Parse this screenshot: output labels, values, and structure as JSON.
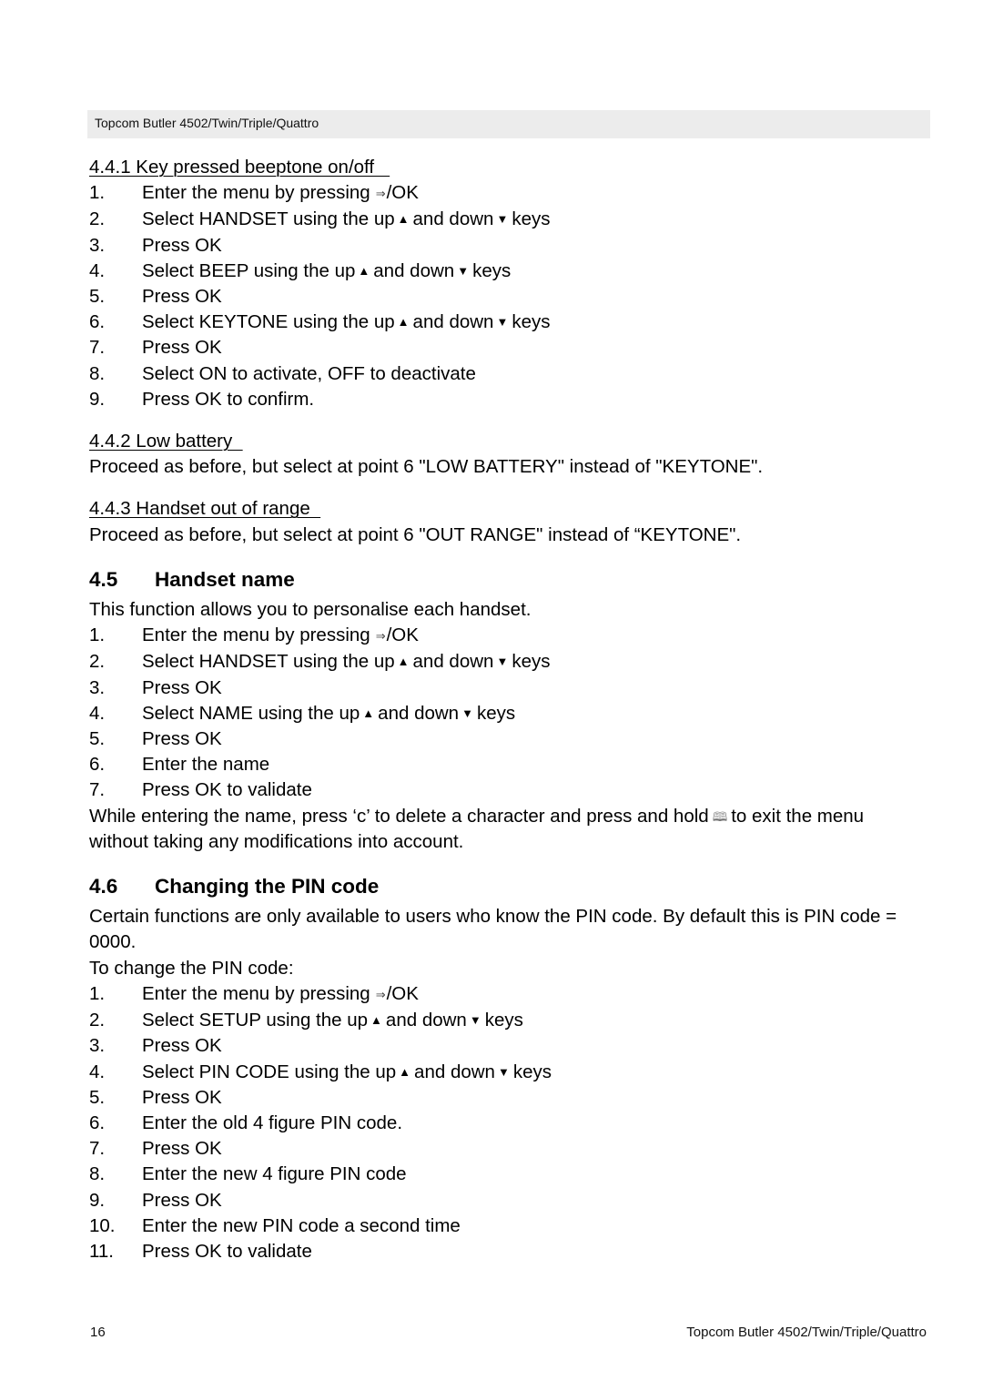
{
  "header": {
    "title": "Topcom Butler 4502/Twin/Triple/Quattro"
  },
  "icons": {
    "enter": "⇒",
    "up": "▲",
    "down": "▼",
    "book": "🕮"
  },
  "section_441": {
    "title": "4.4.1 Key pressed beeptone on/off   ",
    "steps": [
      {
        "num": "1.",
        "pre": "Enter the menu by pressing",
        "icon": "enter",
        "post": "/OK"
      },
      {
        "num": "2.",
        "pre": "Select HANDSET using the up",
        "arrows": true,
        "mid": "and down",
        "post": "keys"
      },
      {
        "num": "3.",
        "text": "Press OK"
      },
      {
        "num": "4.",
        "pre": "Select BEEP using the up",
        "arrows": true,
        "mid": "and down",
        "post": "keys"
      },
      {
        "num": "5.",
        "text": "Press OK"
      },
      {
        "num": "6.",
        "pre": "Select KEYTONE using the up",
        "arrows": true,
        "mid": "and down",
        "post": "keys"
      },
      {
        "num": "7.",
        "text": "Press OK"
      },
      {
        "num": "8.",
        "text": "Select ON to activate, OFF to deactivate"
      },
      {
        "num": "9.",
        "text": "Press OK to confirm."
      }
    ]
  },
  "section_442": {
    "title": "4.4.2 Low battery  ",
    "body": "Proceed as before, but select at point 6 \"LOW BATTERY\" instead of \"KEYTONE\"."
  },
  "section_443": {
    "title": "4.4.3 Handset out of range  ",
    "body": "Proceed as before, but select at point 6 \"OUT RANGE\" instead of “KEYTONE\"."
  },
  "section_45": {
    "number": "4.5",
    "title": "Handset name",
    "intro": "This function allows you to personalise each handset.",
    "steps": [
      {
        "num": "1.",
        "pre": "Enter the menu by pressing",
        "icon": "enter",
        "post": "/OK"
      },
      {
        "num": "2.",
        "pre": "Select HANDSET using the up",
        "arrows": true,
        "mid": "and down",
        "post": "keys"
      },
      {
        "num": "3.",
        "text": "Press OK"
      },
      {
        "num": "4.",
        "pre": "Select NAME using the up",
        "arrows": true,
        "mid": "and down",
        "post": "keys"
      },
      {
        "num": "5.",
        "text": "Press OK"
      },
      {
        "num": "6.",
        "text": "Enter the name"
      },
      {
        "num": "7.",
        "text": "Press OK to validate"
      }
    ],
    "note_pre": "While entering the name, press ‘c’ to delete a character and press and hold",
    "note_post": "to exit the menu without taking any modifications into account."
  },
  "section_46": {
    "number": "4.6",
    "title": "Changing the PIN code",
    "intro": "Certain functions are only available to users who know the PIN code. By default this is PIN code = 0000.",
    "lead": "To change the PIN code:",
    "steps": [
      {
        "num": "1.",
        "pre": "Enter the menu by pressing",
        "icon": "enter",
        "post": "/OK"
      },
      {
        "num": "2.",
        "pre": "Select SETUP using the up",
        "arrows": true,
        "mid": "and down",
        "post": "keys"
      },
      {
        "num": "3.",
        "text": "Press OK"
      },
      {
        "num": "4.",
        "pre": "Select PIN CODE using the up",
        "arrows": true,
        "mid": "and down",
        "post": "keys"
      },
      {
        "num": "5.",
        "text": "Press OK"
      },
      {
        "num": "6.",
        "text": "Enter the old 4 figure PIN code."
      },
      {
        "num": "7.",
        "text": "Press OK"
      },
      {
        "num": "8.",
        "text": "Enter the new 4 figure PIN code"
      },
      {
        "num": "9.",
        "text": "Press OK"
      },
      {
        "num": "10.",
        "text": "Enter the new PIN code a second time"
      },
      {
        "num": "11.",
        "text": "Press OK to validate"
      }
    ]
  },
  "footer": {
    "page_number": "16",
    "title": "Topcom Butler 4502/Twin/Triple/Quattro"
  }
}
